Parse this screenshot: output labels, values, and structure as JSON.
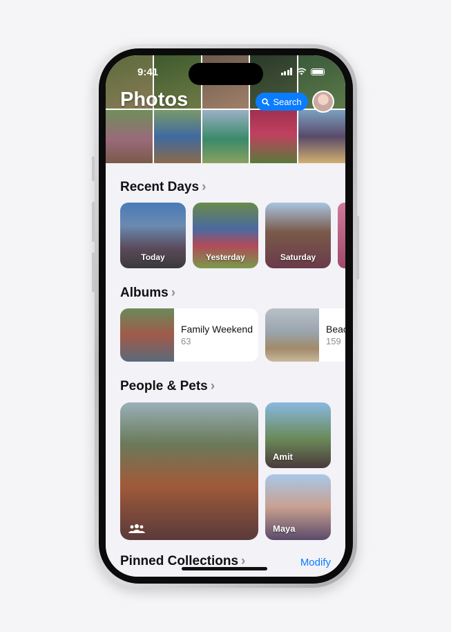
{
  "status_bar": {
    "time": "9:41"
  },
  "header": {
    "title": "Photos",
    "search_label": "Search"
  },
  "icons": {
    "search": "search-icon",
    "avatar": "profile-avatar",
    "group": "people-group-icon"
  },
  "recent_days": {
    "title": "Recent Days",
    "cards": [
      {
        "label": "Today"
      },
      {
        "label": "Yesterday"
      },
      {
        "label": "Saturday"
      }
    ]
  },
  "albums": {
    "title": "Albums",
    "items": [
      {
        "name": "Family Weekend",
        "count": "63"
      },
      {
        "name": "Beac",
        "count": "159"
      }
    ]
  },
  "people_pets": {
    "title": "People & Pets",
    "people": [
      {
        "name": "Amit"
      },
      {
        "name": "Maya"
      }
    ]
  },
  "pinned": {
    "title": "Pinned Collections",
    "modify_label": "Modify"
  },
  "colors": {
    "accent": "#0a7cff",
    "background": "#f2f2f7"
  }
}
